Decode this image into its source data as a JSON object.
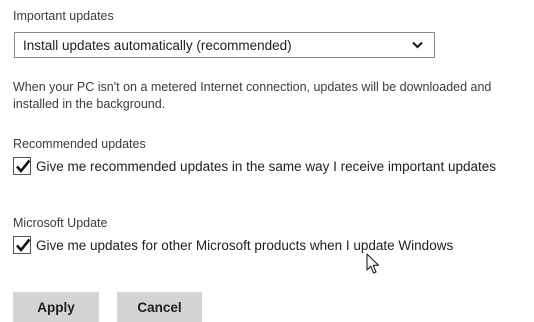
{
  "important": {
    "heading": "Important updates",
    "selected": "Install updates automatically (recommended)",
    "description": "When your PC isn't on a metered Internet connection, updates will be downloaded and installed in the background."
  },
  "recommended": {
    "heading": "Recommended updates",
    "checkbox_label": "Give me recommended updates in the same way I receive important updates",
    "checked": true
  },
  "microsoft_update": {
    "heading": "Microsoft Update",
    "checkbox_label": "Give me updates for other Microsoft products when I update Windows",
    "checked": true
  },
  "buttons": {
    "apply": "Apply",
    "cancel": "Cancel"
  },
  "icons": {
    "dropdown": "chevron-down-icon",
    "check": "checkmark-icon",
    "cursor": "mouse-pointer-icon"
  }
}
